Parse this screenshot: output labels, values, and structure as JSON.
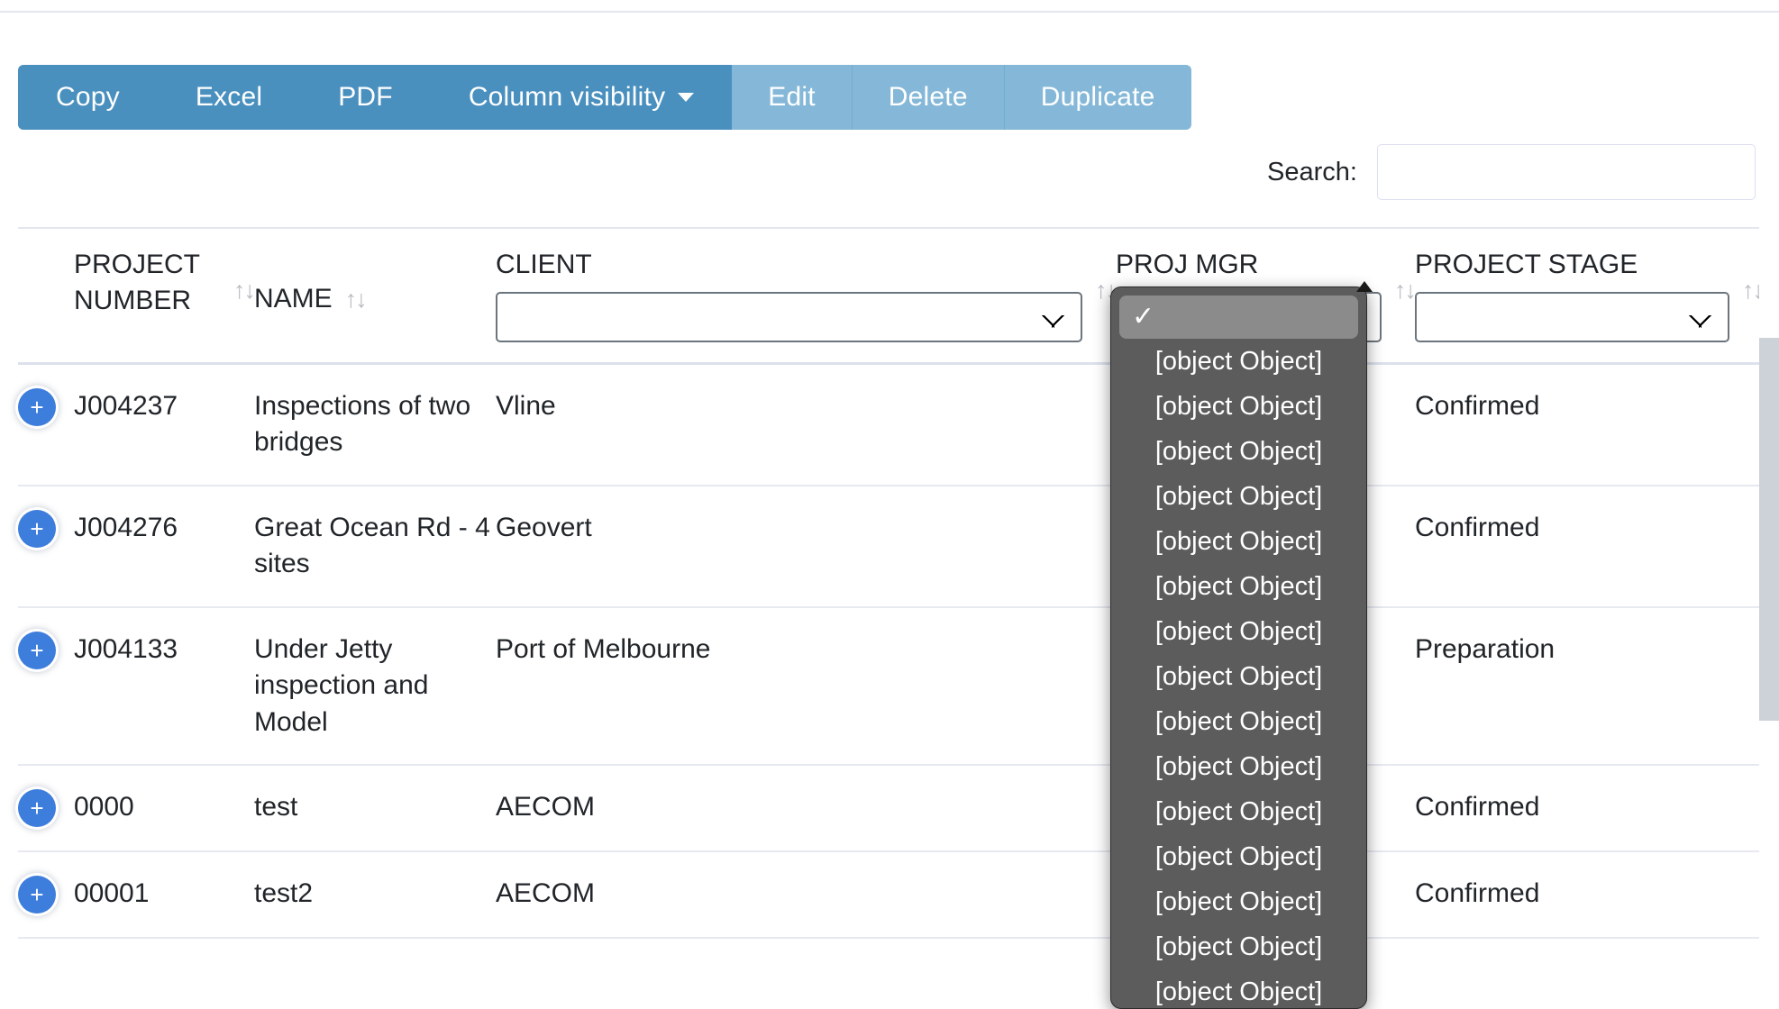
{
  "toolbar": {
    "buttons": [
      {
        "label": "Copy",
        "style": "dark",
        "icon": ""
      },
      {
        "label": "Excel",
        "style": "dark",
        "icon": ""
      },
      {
        "label": "PDF",
        "style": "dark",
        "icon": ""
      },
      {
        "label": "Column visibility",
        "style": "dark",
        "icon": "chevron-down-icon"
      },
      {
        "label": "Edit",
        "style": "light",
        "icon": ""
      },
      {
        "label": "Delete",
        "style": "light",
        "icon": ""
      },
      {
        "label": "Duplicate",
        "style": "light",
        "icon": ""
      }
    ]
  },
  "search": {
    "label": "Search:",
    "value": "",
    "placeholder": ""
  },
  "table": {
    "columns": [
      {
        "label": "PROJECT NUMBER",
        "sortable": true,
        "filter": "none"
      },
      {
        "label": "NAME",
        "sortable": true,
        "filter": "none"
      },
      {
        "label": "CLIENT",
        "sortable": true,
        "filter": "select",
        "filter_value": ""
      },
      {
        "label": "PROJ MGR",
        "sortable": true,
        "filter": "select",
        "filter_value": ""
      },
      {
        "label": "PROJECT STAGE",
        "sortable": true,
        "filter": "select",
        "filter_value": ""
      }
    ],
    "sort_icon": "↑↓",
    "expand_icon": "+",
    "rows": [
      {
        "project_number": "J004237",
        "name": "Inspections of two bridges",
        "client": "Vline",
        "proj_mgr": "",
        "project_stage": "Confirmed",
        "stage_color": "#1b1bdc"
      },
      {
        "project_number": "J004276",
        "name": "Great Ocean Rd - 4 sites",
        "client": "Geovert",
        "proj_mgr": "",
        "project_stage": "Confirmed",
        "stage_color": "#1b1bdc"
      },
      {
        "project_number": "J004133",
        "name": "Under Jetty inspection and Model",
        "client": "Port of Melbourne",
        "proj_mgr": "",
        "project_stage": "Preparation",
        "stage_color": "#2f7d32"
      },
      {
        "project_number": "0000",
        "name": "test",
        "client": "AECOM",
        "proj_mgr": "",
        "project_stage": "Confirmed",
        "stage_color": "#1b1bdc"
      },
      {
        "project_number": "00001",
        "name": "test2",
        "client": "AECOM",
        "proj_mgr": "",
        "project_stage": "Confirmed",
        "stage_color": "#1b1bdc"
      }
    ]
  },
  "proj_mgr_dropdown": {
    "open": true,
    "selected_index": 0,
    "check_glyph": "✓",
    "options": [
      "",
      "[object Object]",
      "[object Object]",
      "[object Object]",
      "[object Object]",
      "[object Object]",
      "[object Object]",
      "[object Object]",
      "[object Object]",
      "[object Object]",
      "[object Object]",
      "[object Object]",
      "[object Object]",
      "[object Object]",
      "[object Object]",
      "[object Object]"
    ]
  },
  "colors": {
    "toolbar_dark": "#4a90bf",
    "toolbar_light": "#85b8d8",
    "expand_button": "#3d7ddc",
    "stage_confirmed": "#1b1bdc",
    "stage_preparation": "#2f7d32",
    "dropdown_bg": "#5d5c5c",
    "dropdown_selected": "#8b8b8b",
    "divider": "#e3e6f0"
  }
}
